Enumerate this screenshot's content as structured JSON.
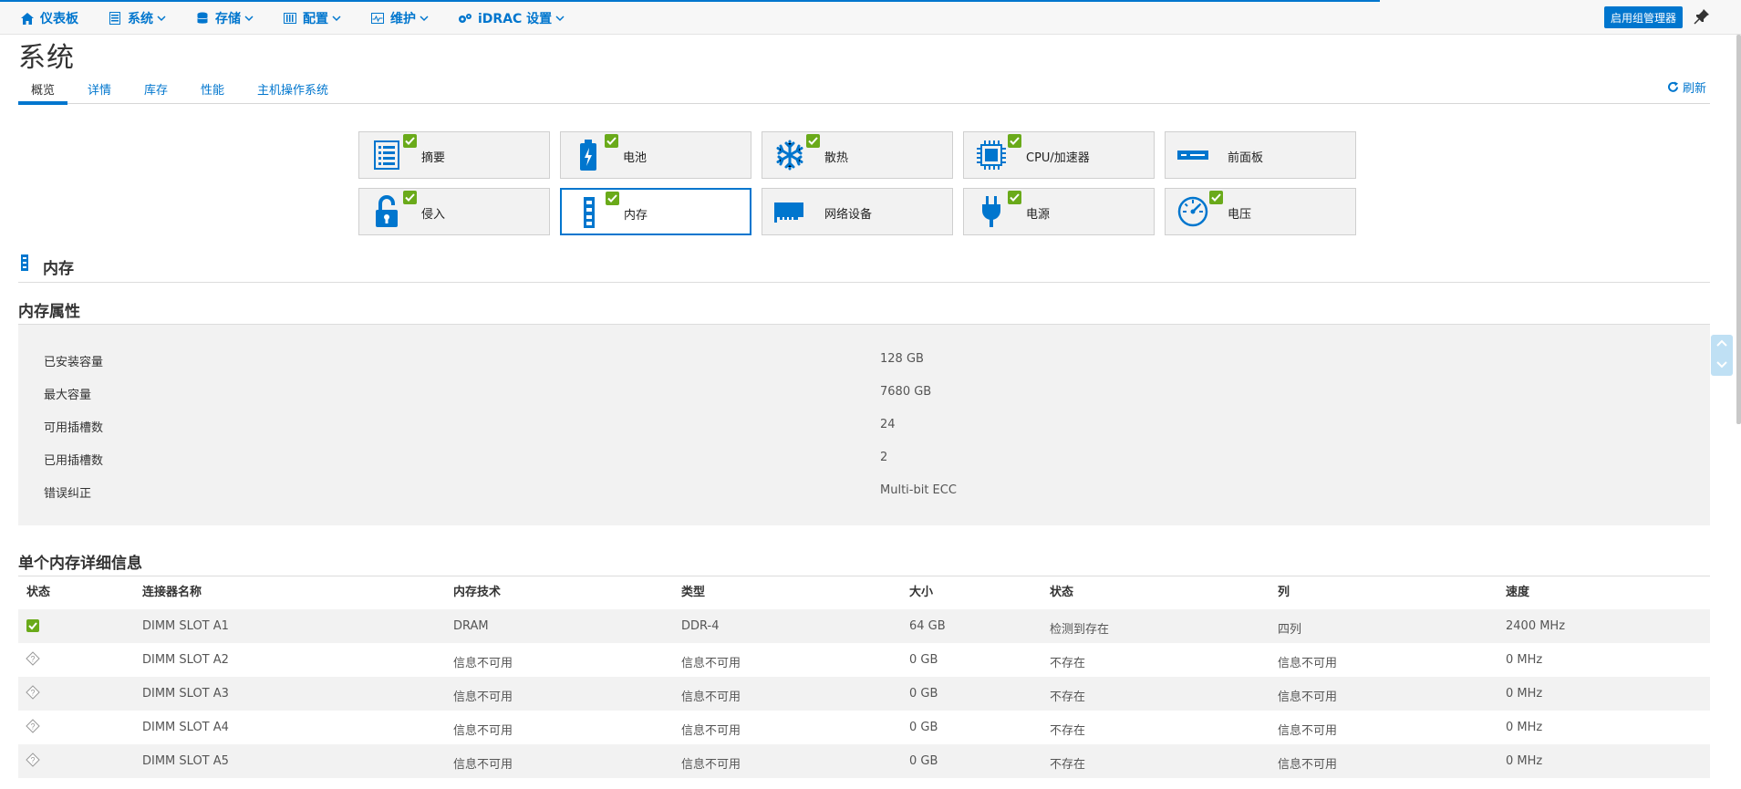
{
  "nav": {
    "dashboard": "仪表板",
    "system": "系统",
    "storage": "存储",
    "config": "配置",
    "maintenance": "维护",
    "idrac": "iDRAC 设置",
    "group_manager": "启用组管理器"
  },
  "page": {
    "title": "系统",
    "refresh": "刷新"
  },
  "tabs": [
    "概览",
    "详情",
    "库存",
    "性能",
    "主机操作系统"
  ],
  "tiles": [
    {
      "label": "摘要",
      "icon": "summary-icon",
      "status": "ok"
    },
    {
      "label": "电池",
      "icon": "battery-icon",
      "status": "ok"
    },
    {
      "label": "散热",
      "icon": "cooling-icon",
      "status": "ok"
    },
    {
      "label": "CPU/加速器",
      "icon": "cpu-icon",
      "status": "ok"
    },
    {
      "label": "前面板",
      "icon": "front-panel-icon",
      "status": ""
    },
    {
      "label": "侵入",
      "icon": "intrusion-lock-icon",
      "status": "ok"
    },
    {
      "label": "内存",
      "icon": "memory-icon",
      "status": "ok",
      "selected": true
    },
    {
      "label": "网络设备",
      "icon": "network-card-icon",
      "status": ""
    },
    {
      "label": "电源",
      "icon": "power-plug-icon",
      "status": "ok"
    },
    {
      "label": "电压",
      "icon": "voltage-gauge-icon",
      "status": "ok"
    }
  ],
  "memory": {
    "heading": "内存",
    "props_heading": "内存属性",
    "props": [
      {
        "label": "已安装容量",
        "value": "128 GB"
      },
      {
        "label": "最大容量",
        "value": "7680 GB"
      },
      {
        "label": "可用插槽数",
        "value": "24"
      },
      {
        "label": "已用插槽数",
        "value": "2"
      },
      {
        "label": "错误纠正",
        "value": "Multi-bit ECC"
      }
    ],
    "detail_heading": "单个内存详细信息",
    "columns": [
      "状态",
      "连接器名称",
      "内存技术",
      "类型",
      "大小",
      "状态",
      "列",
      "速度"
    ],
    "rows": [
      {
        "status": "ok",
        "connector": "DIMM SLOT A1",
        "tech": "DRAM",
        "type": "DDR-4",
        "size": "64 GB",
        "state": "检测到存在",
        "rank": "四列",
        "speed": "2400 MHz"
      },
      {
        "status": "unknown",
        "connector": "DIMM SLOT A2",
        "tech": "信息不可用",
        "type": "信息不可用",
        "size": "0 GB",
        "state": "不存在",
        "rank": "信息不可用",
        "speed": "0 MHz"
      },
      {
        "status": "unknown",
        "connector": "DIMM SLOT A3",
        "tech": "信息不可用",
        "type": "信息不可用",
        "size": "0 GB",
        "state": "不存在",
        "rank": "信息不可用",
        "speed": "0 MHz"
      },
      {
        "status": "unknown",
        "connector": "DIMM SLOT A4",
        "tech": "信息不可用",
        "type": "信息不可用",
        "size": "0 GB",
        "state": "不存在",
        "rank": "信息不可用",
        "speed": "0 MHz"
      },
      {
        "status": "unknown",
        "connector": "DIMM SLOT A5",
        "tech": "信息不可用",
        "type": "信息不可用",
        "size": "0 GB",
        "state": "不存在",
        "rank": "信息不可用",
        "speed": "0 MHz"
      }
    ]
  },
  "colors": {
    "accent": "#0076ce",
    "ok": "#6aaa1a"
  }
}
